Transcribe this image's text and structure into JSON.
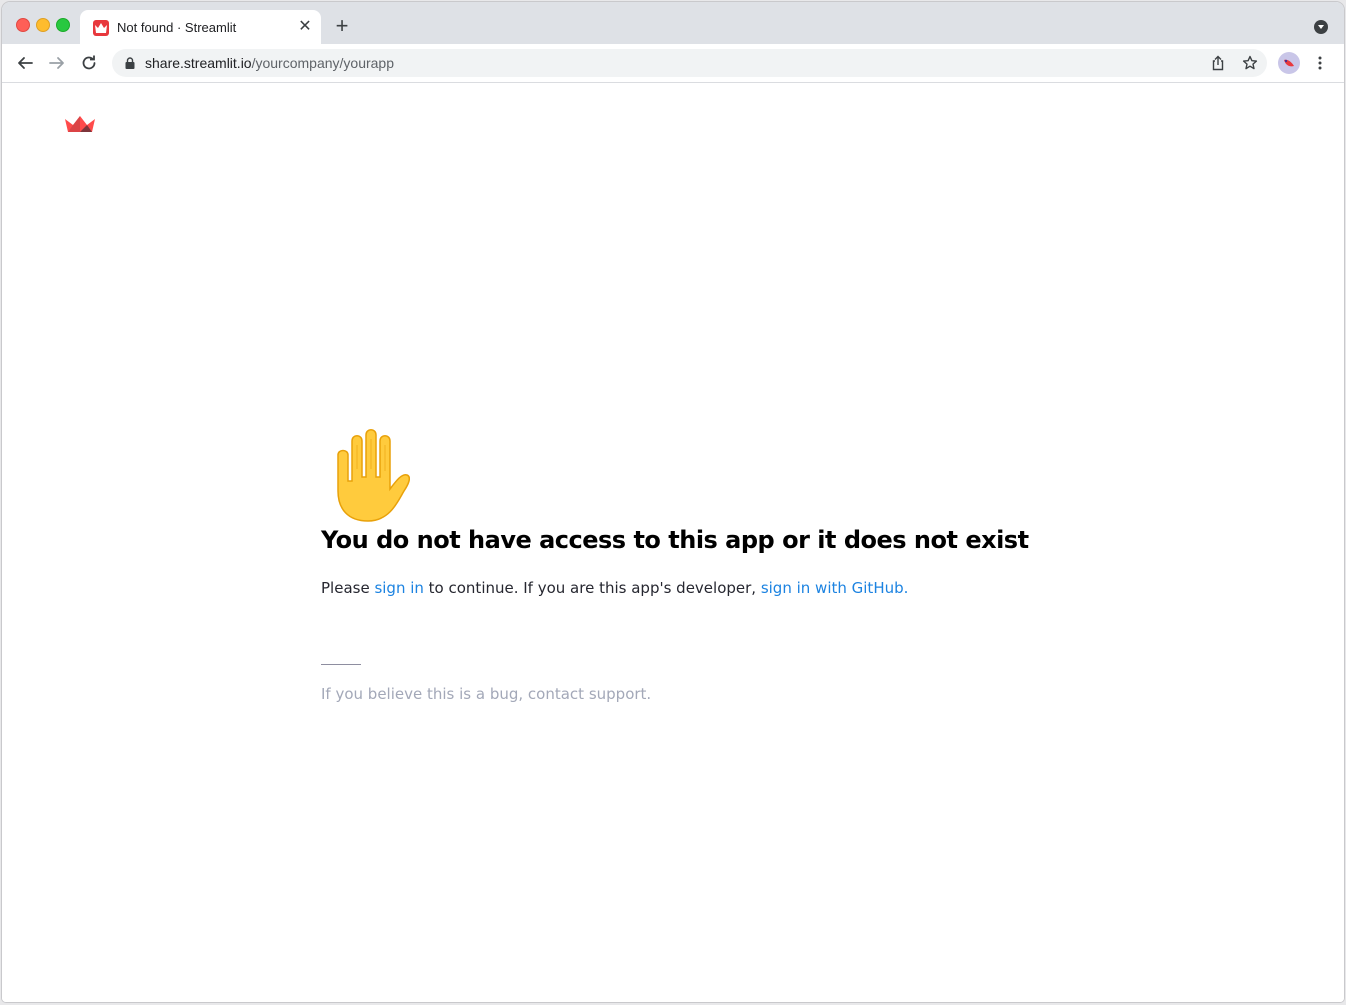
{
  "browser": {
    "tab": {
      "title": "Not found · Streamlit",
      "close_glyph": "✕",
      "favicon_icon": "streamlit-logo-icon"
    },
    "new_tab_glyph": "+",
    "url": {
      "host": "share.streamlit.io",
      "path": "/yourcompany/yourapp"
    },
    "icons": {
      "back": "arrow-left-icon",
      "forward": "arrow-right-icon",
      "reload": "reload-icon",
      "lock": "lock-icon",
      "share": "share-icon",
      "bookmark": "star-icon",
      "profile": "avatar",
      "menu": "more-vert-icon",
      "tab_search": "chevron-down-icon"
    }
  },
  "page": {
    "hand_emoji": "✋",
    "heading": "You do not have access to this app or it does not exist",
    "message": {
      "prefix": "Please ",
      "sign_in_link": "sign in",
      "middle": " to continue. If you are this app's developer, ",
      "github_link": "sign in with GitHub."
    },
    "support_text": "If you believe this is a bug, contact support."
  },
  "colors": {
    "streamlit_red": "#ff4b4b",
    "link_blue": "#1c83e1",
    "muted_gray": "#a3a8b8"
  }
}
